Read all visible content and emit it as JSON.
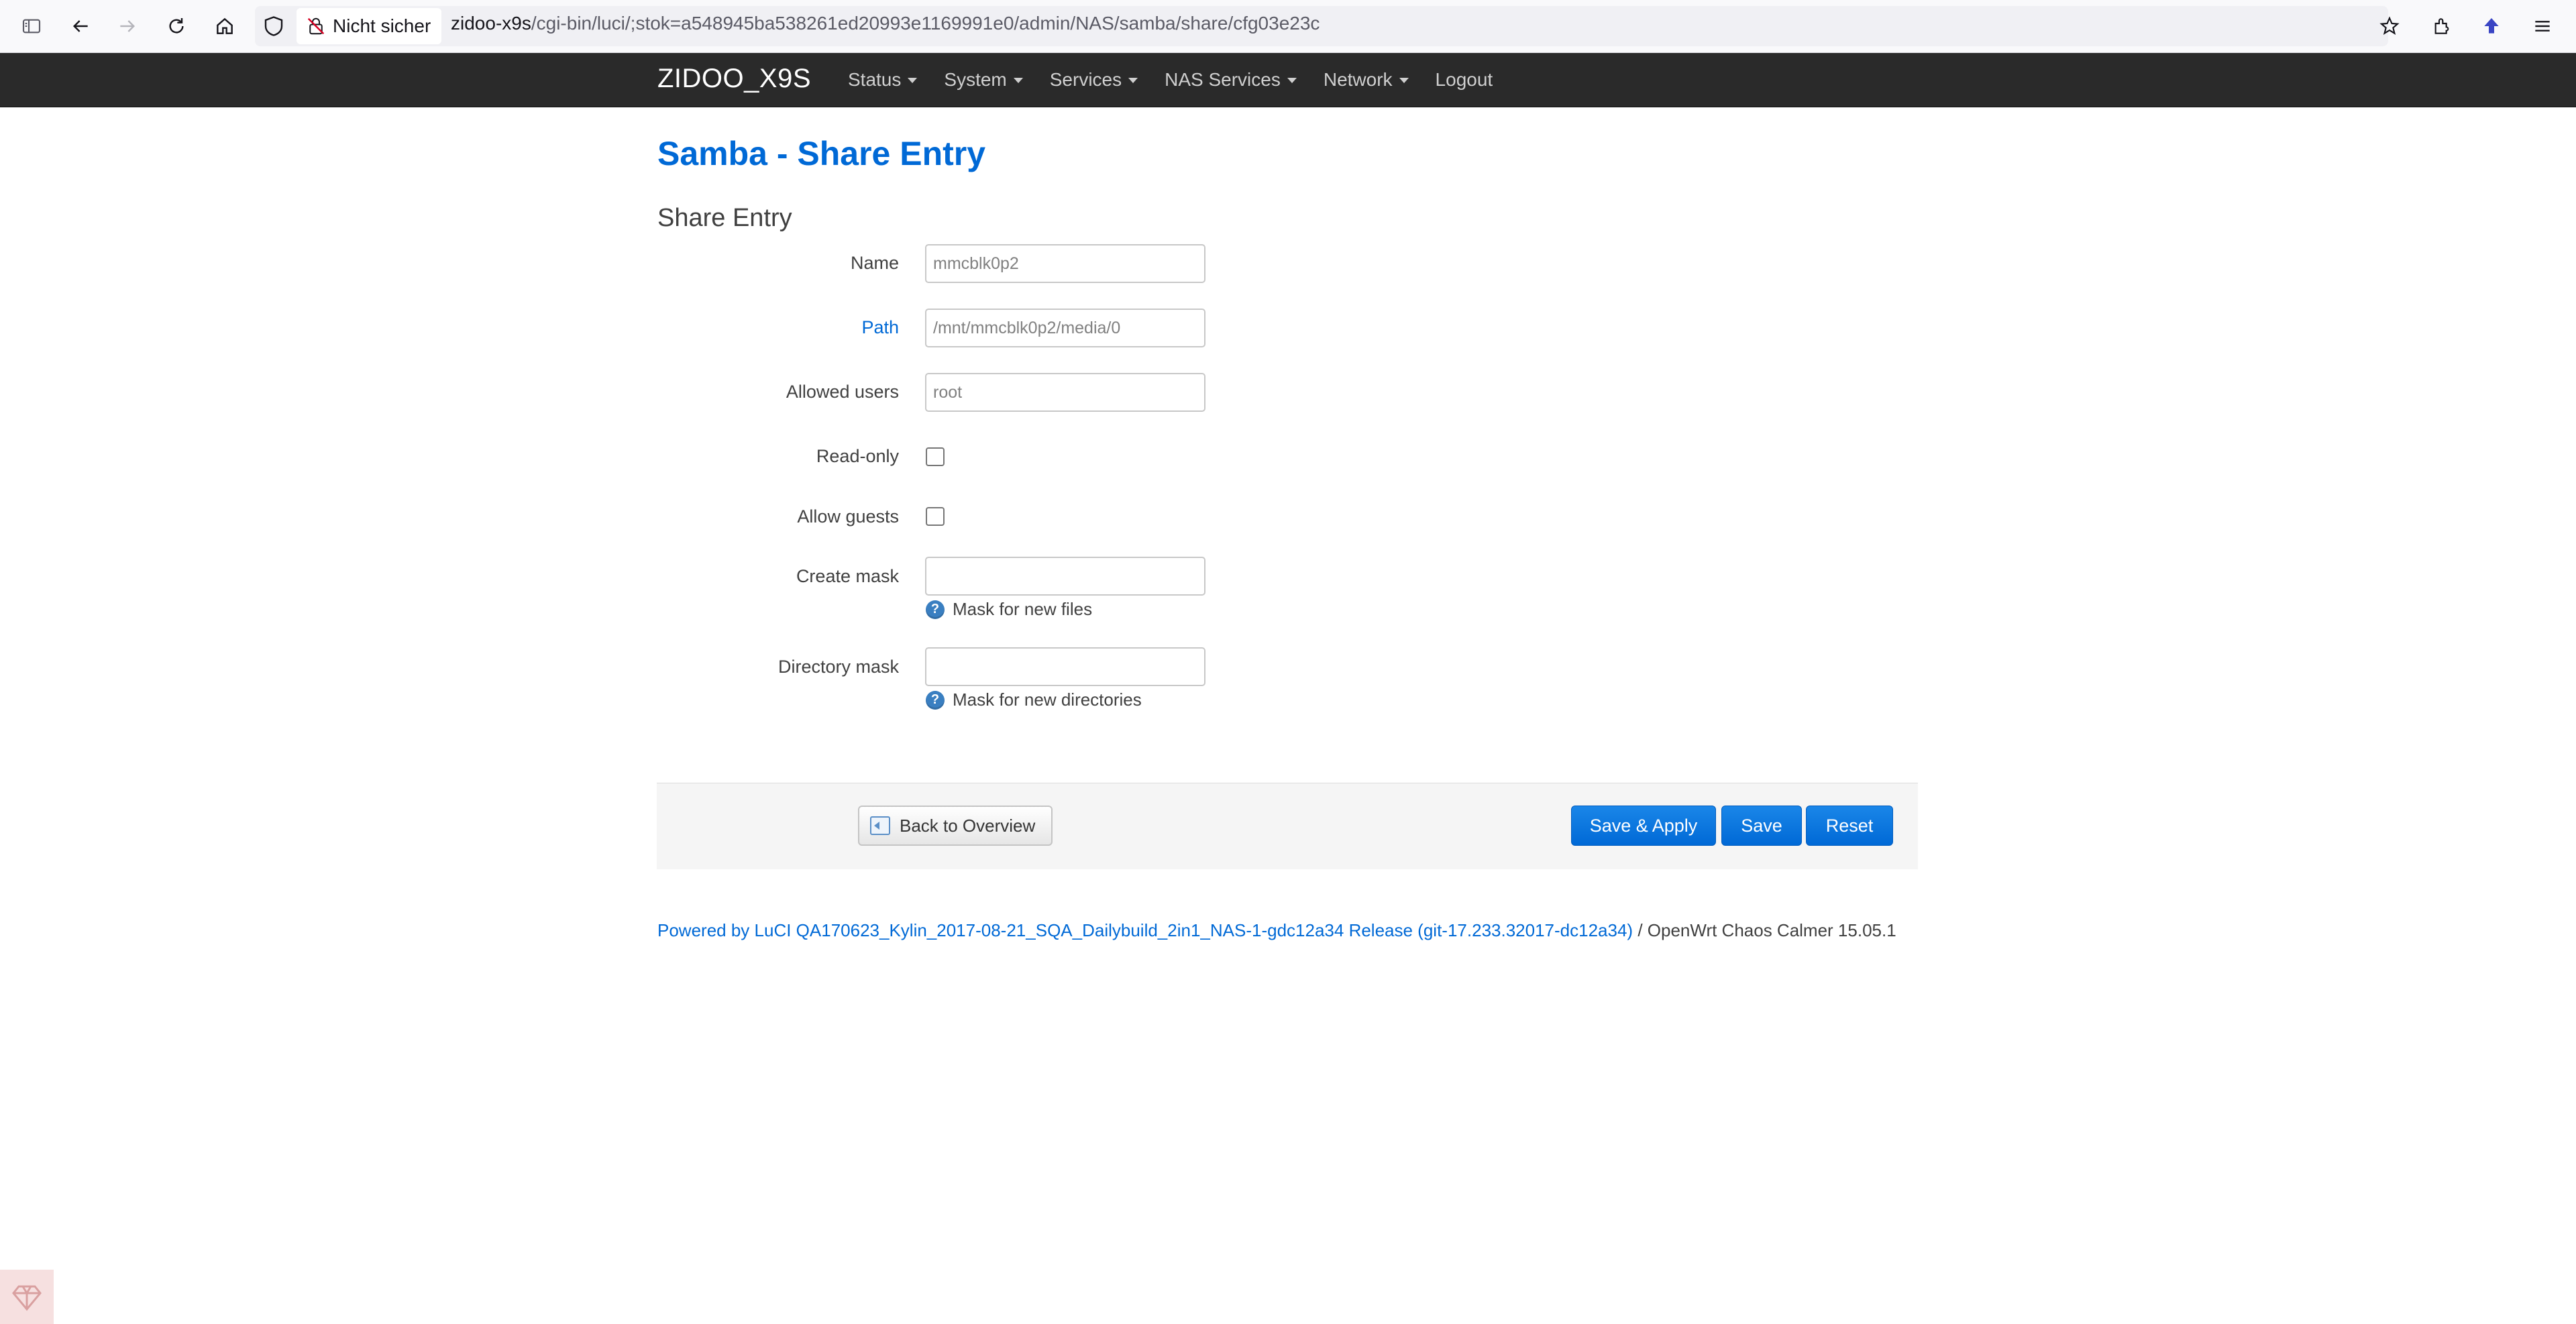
{
  "browser": {
    "security_label": "Nicht sicher",
    "url_host": "zidoo-x9s",
    "url_path": "/cgi-bin/luci/;stok=a548945ba538261ed20993e1169991e0/admin/NAS/samba/share/cfg03e23c",
    "icons": [
      "sidebar-icon",
      "back-icon",
      "forward-icon",
      "reload-icon",
      "home-icon",
      "shield-icon",
      "not-secure-lock-icon",
      "bookmark-star-icon",
      "extensions-icon",
      "profile-icon",
      "menu-icon"
    ]
  },
  "header": {
    "brand": "ZIDOO_X9S",
    "menu": [
      {
        "label": "Status"
      },
      {
        "label": "System"
      },
      {
        "label": "Services"
      },
      {
        "label": "NAS Services"
      },
      {
        "label": "Network"
      },
      {
        "label": "Logout"
      }
    ]
  },
  "page": {
    "title": "Samba - Share Entry",
    "section_title": "Share Entry"
  },
  "form": {
    "name": {
      "label": "Name",
      "value": "mmcblk0p2"
    },
    "path": {
      "label": "Path",
      "value": "/mnt/mmcblk0p2/media/0"
    },
    "users": {
      "label": "Allowed users",
      "value": "root"
    },
    "readonly": {
      "label": "Read-only",
      "checked": false
    },
    "guests": {
      "label": "Allow guests",
      "checked": false
    },
    "create_mask": {
      "label": "Create mask",
      "value": "",
      "hint": "Mask for new files"
    },
    "dir_mask": {
      "label": "Directory mask",
      "value": "",
      "hint": "Mask for new directories"
    }
  },
  "actions": {
    "back": "Back to Overview",
    "save_apply": "Save & Apply",
    "save": "Save",
    "reset": "Reset"
  },
  "footer": {
    "powered": "Powered by LuCI QA170623_Kylin_2017-08-21_SQA_Dailybuild_2in1_NAS-1-gdc12a34 Release (git-17.233.32017-dc12a34)",
    "os": " / OpenWrt Chaos Calmer 15.05.1"
  },
  "colors": {
    "accent": "#0069d6",
    "navbar": "#2a2a2a",
    "button": "#0069d6"
  }
}
